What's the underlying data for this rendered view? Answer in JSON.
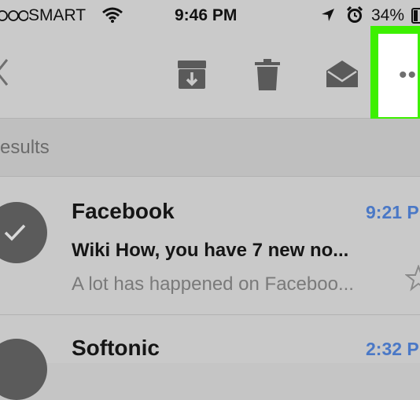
{
  "status_bar": {
    "carrier": "SMART",
    "time": "9:46 PM",
    "battery": "34%",
    "icons": [
      "signal-dots-icon",
      "wifi-icon",
      "location-arrow-icon",
      "alarm-icon",
      "battery-icon"
    ]
  },
  "toolbar": {
    "icons": [
      "back-chevron-icon",
      "archive-icon",
      "trash-icon",
      "mark-unread-envelope-icon",
      "more-options-icon"
    ],
    "more_label": "••",
    "highlight_color": "#3df000"
  },
  "section": {
    "title": "esults"
  },
  "emails": [
    {
      "sender": "Facebook",
      "time": "9:21 P",
      "subject": "Wiki How, you have 7 new no...",
      "preview": "A lot has happened on Faceboo..."
    },
    {
      "sender": "Softonic",
      "time": "2:32 P"
    }
  ],
  "colors": {
    "time_blue": "#4a78c6",
    "overlay_gray": "#c9c9c9",
    "avatar_gray": "#5b5b5b"
  }
}
